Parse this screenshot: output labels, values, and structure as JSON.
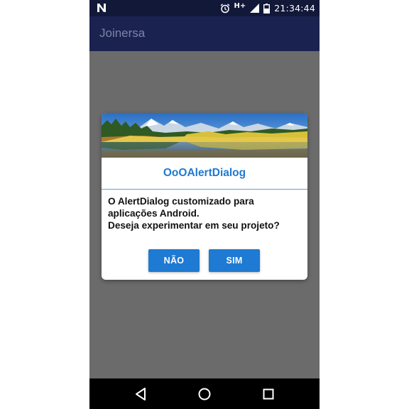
{
  "status_bar": {
    "notification_icon": "n-notification-icon",
    "network_type": "H+",
    "time": "21:34:44",
    "icons": [
      "alarm-clock-icon",
      "signal-strength-icon",
      "battery-icon"
    ]
  },
  "app_bar": {
    "title": "Joinersa"
  },
  "dialog": {
    "header_image": "landscape-lake-mountains-image",
    "title": "OoOAlertDialog",
    "message_lines": [
      "O AlertDialog customizado para",
      "aplicações Android.",
      "Deseja experimentar em seu projeto?"
    ],
    "buttons": {
      "negative": "NÃO",
      "positive": "SIM"
    },
    "colors": {
      "accent": "#1e7ad2"
    }
  },
  "nav_bar": {
    "icons": [
      "back-triangle-icon",
      "home-circle-icon",
      "recents-square-icon"
    ]
  },
  "colors": {
    "status_bar": "#121838",
    "app_bar": "#1a2250",
    "scrim": "#6b6b6b"
  }
}
